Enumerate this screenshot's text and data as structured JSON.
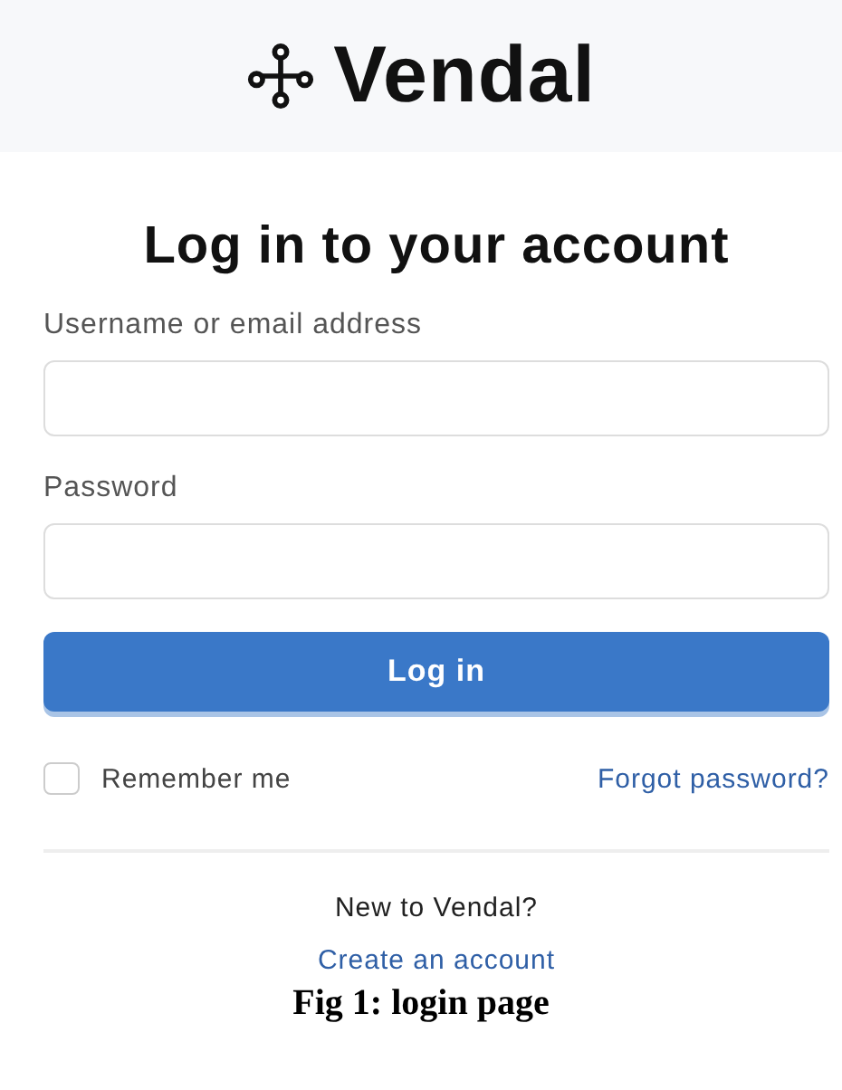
{
  "brand": {
    "name": "Vendal"
  },
  "title": "Log in to your account",
  "fields": [
    {
      "label": "Username or email address"
    },
    {
      "label": "Password"
    }
  ],
  "submit": "Log in",
  "remember": {
    "label": "Remember me",
    "checked": false
  },
  "forgot": "Forgot password?",
  "signup": {
    "prompt": "New to Vendal?",
    "link": "Create an account"
  },
  "caption": "Fig 1: login page"
}
